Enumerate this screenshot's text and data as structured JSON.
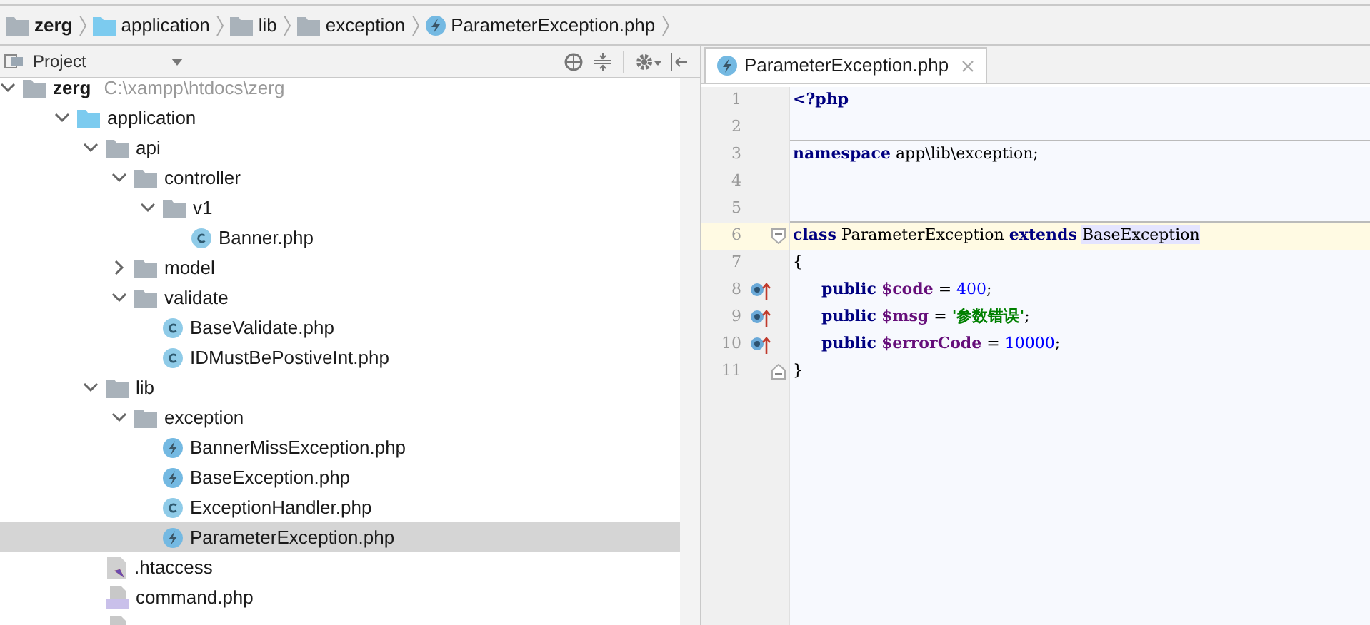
{
  "breadcrumbs": [
    {
      "label": "zerg",
      "kind": "folder"
    },
    {
      "label": "application",
      "kind": "source-folder"
    },
    {
      "label": "lib",
      "kind": "folder"
    },
    {
      "label": "exception",
      "kind": "folder"
    },
    {
      "label": "ParameterException.php",
      "kind": "php-exception"
    }
  ],
  "project_panel": {
    "title": "Project",
    "tree": [
      {
        "label": "zerg",
        "path": "C:\\xampp\\htdocs\\zerg",
        "kind": "folder",
        "expanded": true,
        "selected": false,
        "children": [
          {
            "label": "application",
            "kind": "source-folder",
            "expanded": true,
            "selected": false,
            "children": [
              {
                "label": "api",
                "kind": "folder",
                "expanded": true,
                "selected": false,
                "children": [
                  {
                    "label": "controller",
                    "kind": "folder",
                    "expanded": true,
                    "selected": false,
                    "children": [
                      {
                        "label": "v1",
                        "kind": "folder",
                        "expanded": true,
                        "selected": false,
                        "children": [
                          {
                            "label": "Banner.php",
                            "kind": "php-class",
                            "selected": false
                          }
                        ]
                      }
                    ]
                  },
                  {
                    "label": "model",
                    "kind": "folder",
                    "expanded": false,
                    "selected": false
                  },
                  {
                    "label": "validate",
                    "kind": "folder",
                    "expanded": true,
                    "selected": false,
                    "children": [
                      {
                        "label": "BaseValidate.php",
                        "kind": "php-class",
                        "selected": false
                      },
                      {
                        "label": "IDMustBePostiveInt.php",
                        "kind": "php-class",
                        "selected": false
                      }
                    ]
                  }
                ]
              },
              {
                "label": "lib",
                "kind": "folder",
                "expanded": true,
                "selected": false,
                "children": [
                  {
                    "label": "exception",
                    "kind": "folder",
                    "expanded": true,
                    "selected": false,
                    "children": [
                      {
                        "label": "BannerMissException.php",
                        "kind": "php-exception",
                        "selected": false
                      },
                      {
                        "label": "BaseException.php",
                        "kind": "php-exception",
                        "selected": false
                      },
                      {
                        "label": "ExceptionHandler.php",
                        "kind": "php-class",
                        "selected": false
                      },
                      {
                        "label": "ParameterException.php",
                        "kind": "php-exception",
                        "selected": true
                      }
                    ]
                  }
                ]
              },
              {
                "label": ".htaccess",
                "kind": "htaccess",
                "selected": false
              },
              {
                "label": "command.php",
                "kind": "php-file",
                "selected": false
              },
              {
                "kind": "php-file",
                "selected": false
              }
            ]
          }
        ]
      }
    ]
  },
  "editor": {
    "tabs": [
      {
        "label": "ParameterException.php",
        "kind": "php-exception",
        "selected": true
      }
    ],
    "lines": [
      {
        "number": "1",
        "tokens": [
          {
            "kind": "keyword",
            "text": "<?php"
          }
        ]
      },
      {
        "number": "2",
        "separator": true
      },
      {
        "number": "3",
        "tokens": [
          {
            "kind": "keyword",
            "text": "namespace"
          },
          {
            "kind": "plain",
            "text": "app\\lib\\exception;"
          }
        ]
      },
      {
        "number": "4"
      },
      {
        "number": "5",
        "separator": true
      },
      {
        "number": "6",
        "current": true,
        "fold_start": true,
        "tokens": [
          {
            "kind": "keyword",
            "text": "class"
          },
          {
            "kind": "plain",
            "text": "ParameterException"
          },
          {
            "kind": "keyword",
            "text": "extends"
          },
          {
            "kind": "reference",
            "text": "BaseException"
          }
        ]
      },
      {
        "number": "7",
        "tokens": [
          {
            "kind": "plain",
            "text": "{"
          }
        ]
      },
      {
        "number": "8",
        "overrides": true,
        "indented": true,
        "tokens": [
          {
            "kind": "keyword",
            "text": "public"
          },
          {
            "kind": "variable",
            "text": "$code"
          },
          {
            "kind": "plain",
            "text": "="
          },
          {
            "kind": "number",
            "text": "400"
          },
          {
            "kind": "punctuation",
            "text": ";"
          }
        ]
      },
      {
        "number": "9",
        "overrides": true,
        "indented": true,
        "tokens": [
          {
            "kind": "keyword",
            "text": "public"
          },
          {
            "kind": "variable",
            "text": "$msg"
          },
          {
            "kind": "plain",
            "text": "="
          },
          {
            "kind": "string",
            "text": "'参数错误'"
          },
          {
            "kind": "punctuation",
            "text": ";"
          }
        ]
      },
      {
        "number": "10",
        "overrides": true,
        "indented": true,
        "tokens": [
          {
            "kind": "keyword",
            "text": "public"
          },
          {
            "kind": "variable",
            "text": "$errorCode"
          },
          {
            "kind": "plain",
            "text": "="
          },
          {
            "kind": "number",
            "text": "10000"
          },
          {
            "kind": "punctuation",
            "text": ";"
          }
        ]
      },
      {
        "number": "11",
        "fold_end": true,
        "tokens": [
          {
            "kind": "plain",
            "text": "}"
          }
        ]
      }
    ]
  }
}
